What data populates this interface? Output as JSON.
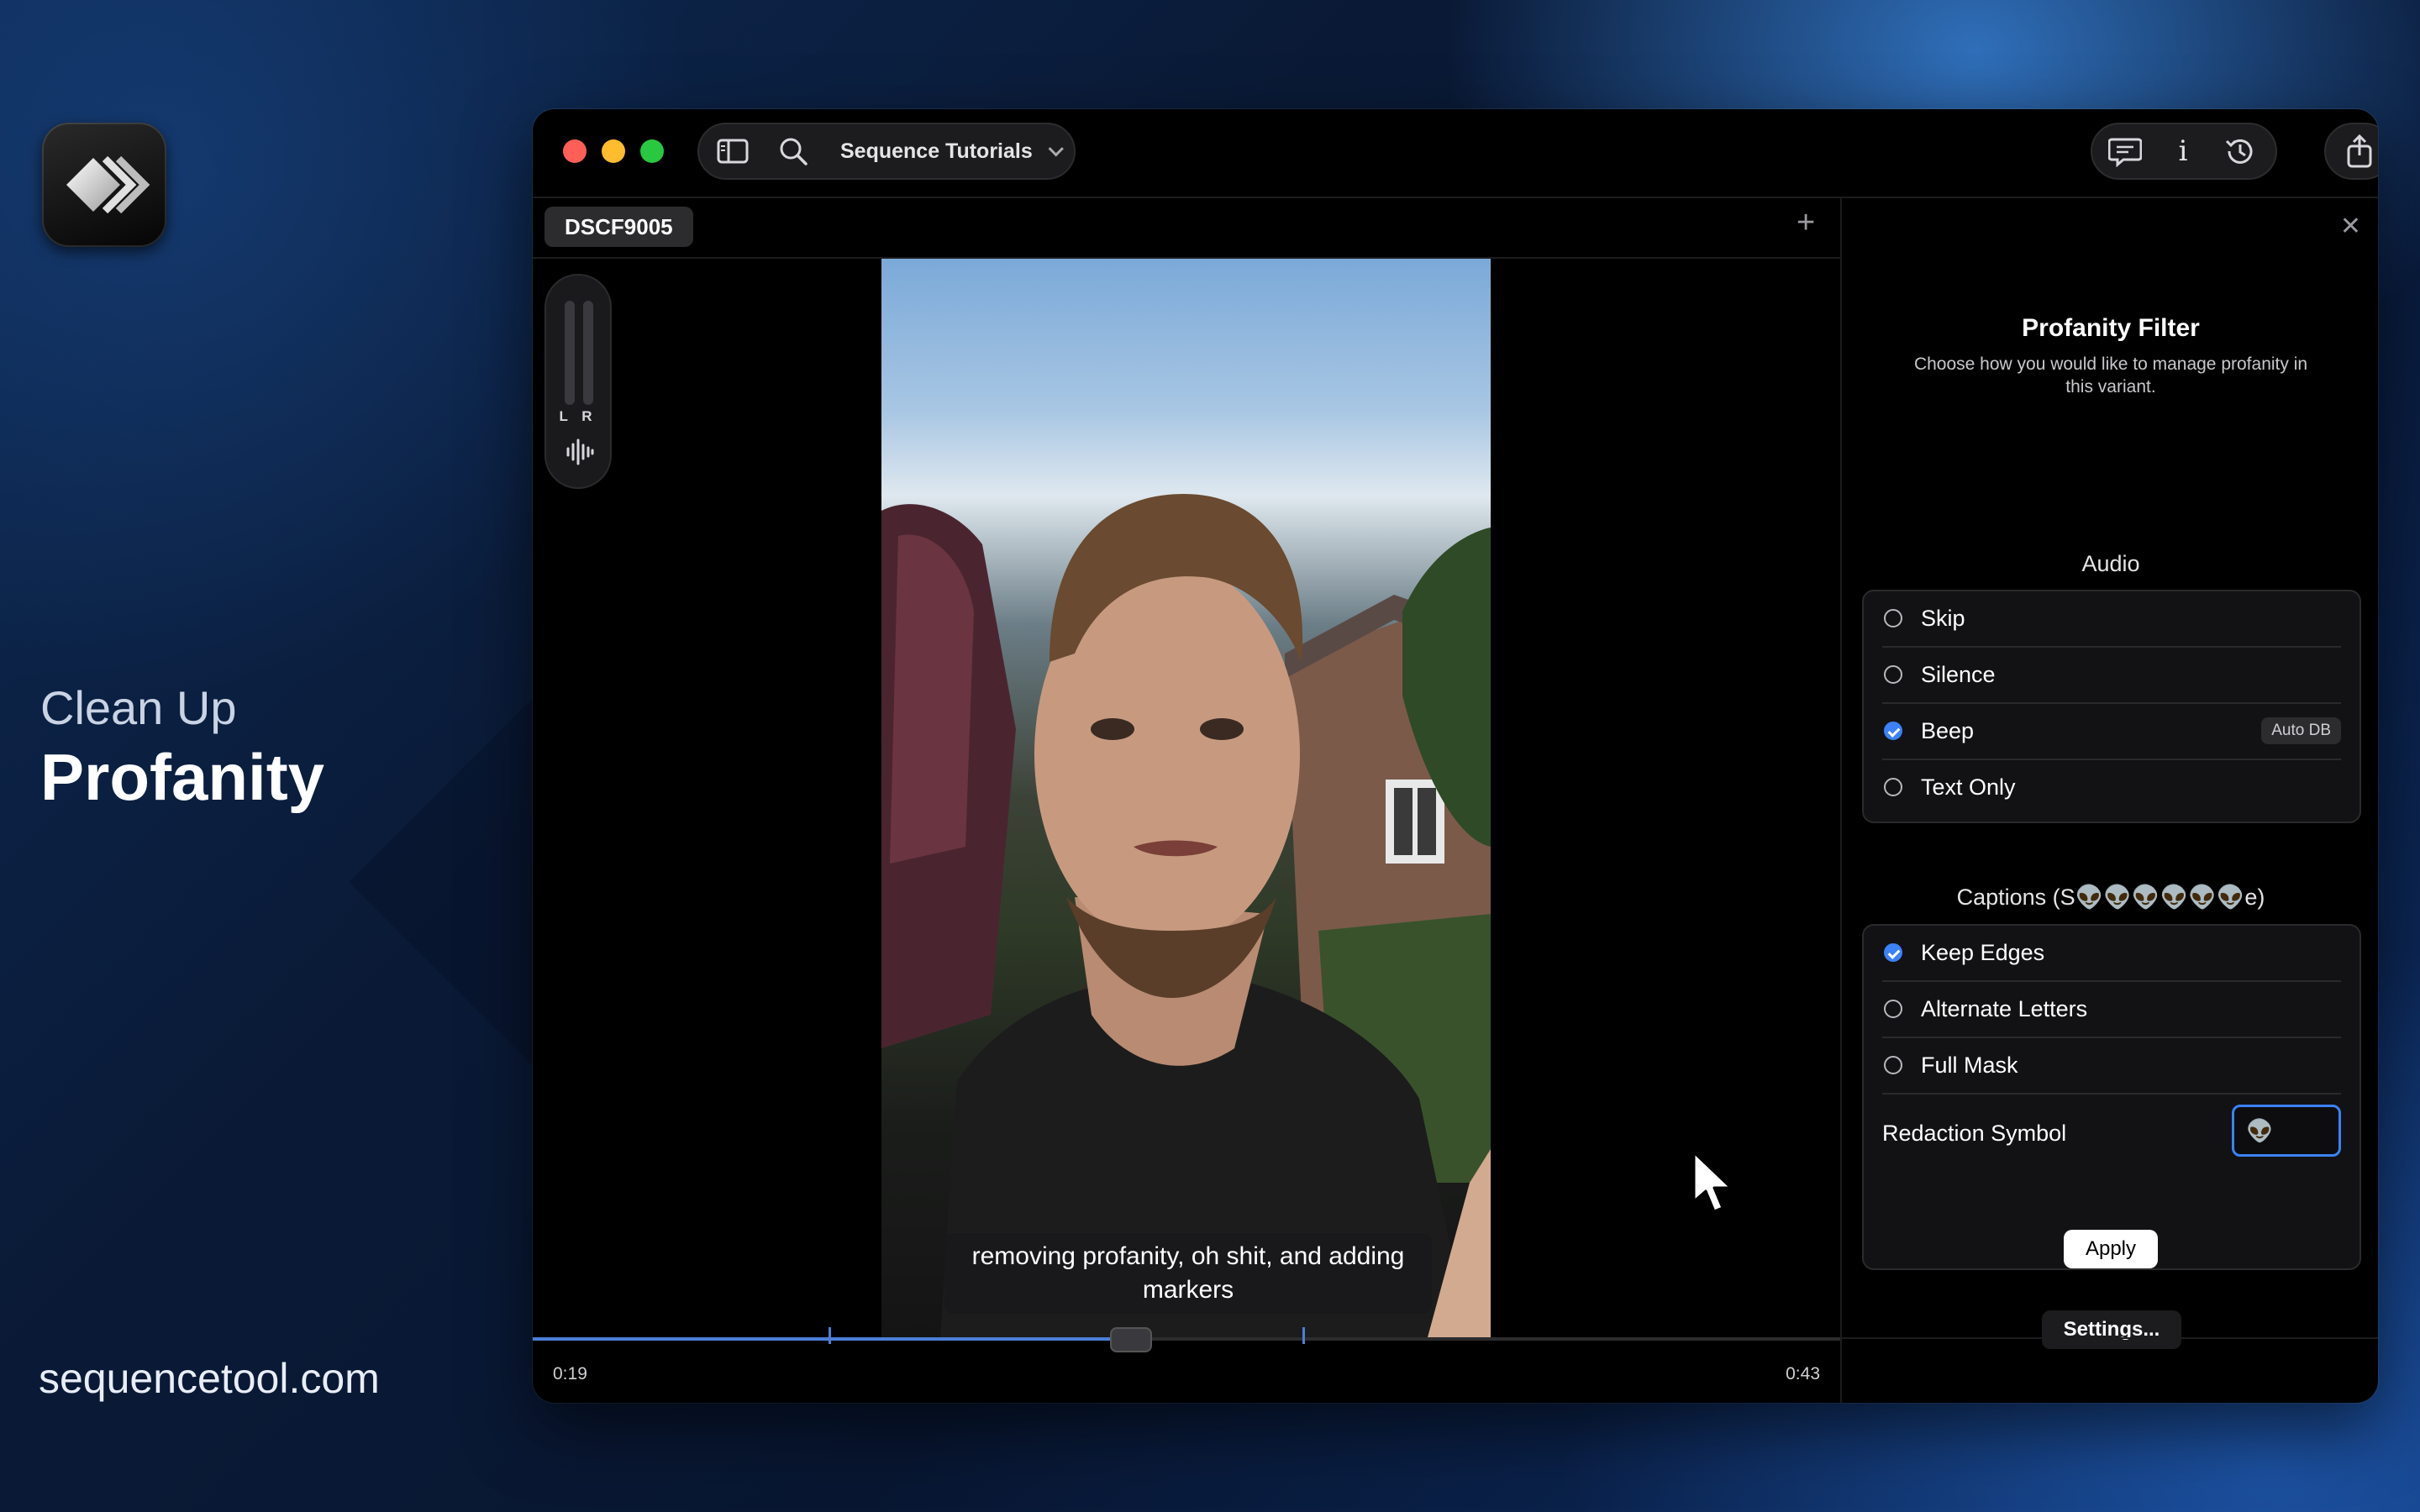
{
  "brand": {
    "tagline_line1": "Clean Up",
    "tagline_line2": "Profanity",
    "website": "sequencetool.com"
  },
  "window": {
    "project_name": "Sequence Tutorials",
    "tab_name": "DSCF9005",
    "meter_label": "L R",
    "toolbar_icons": [
      "sidebar-icon",
      "search-icon",
      "captions-icon",
      "info-icon",
      "history-icon",
      "share-icon"
    ]
  },
  "player": {
    "caption_text": "removing profanity, oh shit, and adding markers",
    "time_current": "0:19",
    "time_total": "0:43",
    "progress": 0.456
  },
  "panel": {
    "title": "Profanity Filter",
    "subtitle": "Choose how you would like to manage profanity in this variant.",
    "audio": {
      "title": "Audio",
      "options": [
        {
          "label": "Skip",
          "selected": false
        },
        {
          "label": "Silence",
          "selected": false
        },
        {
          "label": "Beep",
          "selected": true,
          "badge": "Auto DB"
        },
        {
          "label": "Text Only",
          "selected": false
        }
      ]
    },
    "captions": {
      "title": "Captions (S👽👽👽👽👽👽e)",
      "options": [
        {
          "label": "Keep Edges",
          "selected": true
        },
        {
          "label": "Alternate Letters",
          "selected": false
        },
        {
          "label": "Full Mask",
          "selected": false
        }
      ],
      "redaction_label": "Redaction Symbol",
      "redaction_value": "👽"
    },
    "apply_label": "Apply",
    "settings_label": "Settings..."
  },
  "colors": {
    "accent": "#3b82f6",
    "close_light": "#ff5f57",
    "minimize_light": "#febc2e",
    "zoom_light": "#28c840"
  }
}
